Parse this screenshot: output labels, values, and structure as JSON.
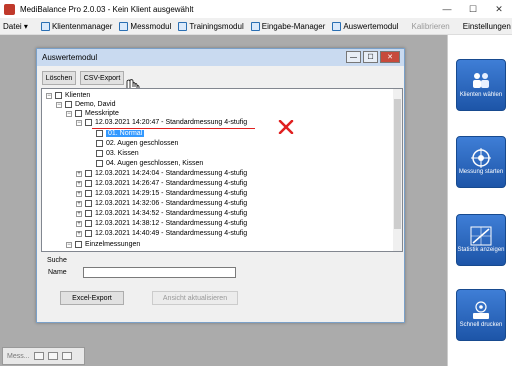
{
  "window": {
    "title": "MediBalance Pro   2.0.03 - Kein Klient ausgewählt",
    "minimize": "—",
    "maximize": "☐",
    "close": "✕"
  },
  "menu": {
    "datei": "Datei",
    "klientenmanager": "Klientenmanager",
    "messmodul": "Messmodul",
    "trainingsmodul": "Trainingsmodul",
    "eingabe_manager": "Eingabe-Manager",
    "auswertemodul": "Auswertemodul",
    "kalibrieren": "Kalibrieren",
    "einstellungen": "Einstellungen"
  },
  "dialog": {
    "title": "Auswertemodul",
    "btn_loeschen": "Löschen",
    "btn_csv": "CSV-Export",
    "tree": {
      "klienten": "Klienten",
      "demo": "Demo, David",
      "messkripte": "Messkripte",
      "session_expanded": "12.03.2021 14:20:47 - Standardmessung 4-stufig",
      "sub_items": [
        "01. Normal",
        "02. Augen geschlossen",
        "03. Kissen",
        "04. Augen geschlossen, Kissen"
      ],
      "sessions": [
        "12.03.2021 14:24:04 - Standardmessung 4-stufig",
        "12.03.2021 14:26:47 - Standardmessung 4-stufig",
        "12.03.2021 14:29:15 - Standardmessung 4-stufig",
        "12.03.2021 14:32:06 - Standardmessung 4-stufig",
        "12.03.2021 14:34:52 - Standardmessung 4-stufig",
        "12.03.2021 14:38:12 - Standardmessung 4-stufig",
        "12.03.2021 14:40:49 - Standardmessung 4-stufig"
      ],
      "einzelmessungen": "Einzelmessungen"
    },
    "search": {
      "label": "Suche",
      "name_label": "Name",
      "name_value": "",
      "btn_excel": "Excel-Export",
      "btn_refresh": "Ansicht aktualisieren"
    }
  },
  "right_panel": {
    "tile1": "Klienten wählen",
    "tile2": "Messung starten",
    "tile3": "Statistik anzeigen",
    "tile4": "Schnell drucken"
  },
  "minimized": {
    "label": "Mess..."
  },
  "colors": {
    "accent": "#3399ff",
    "tile": "#2a63b8",
    "annotation": "#e02020"
  }
}
